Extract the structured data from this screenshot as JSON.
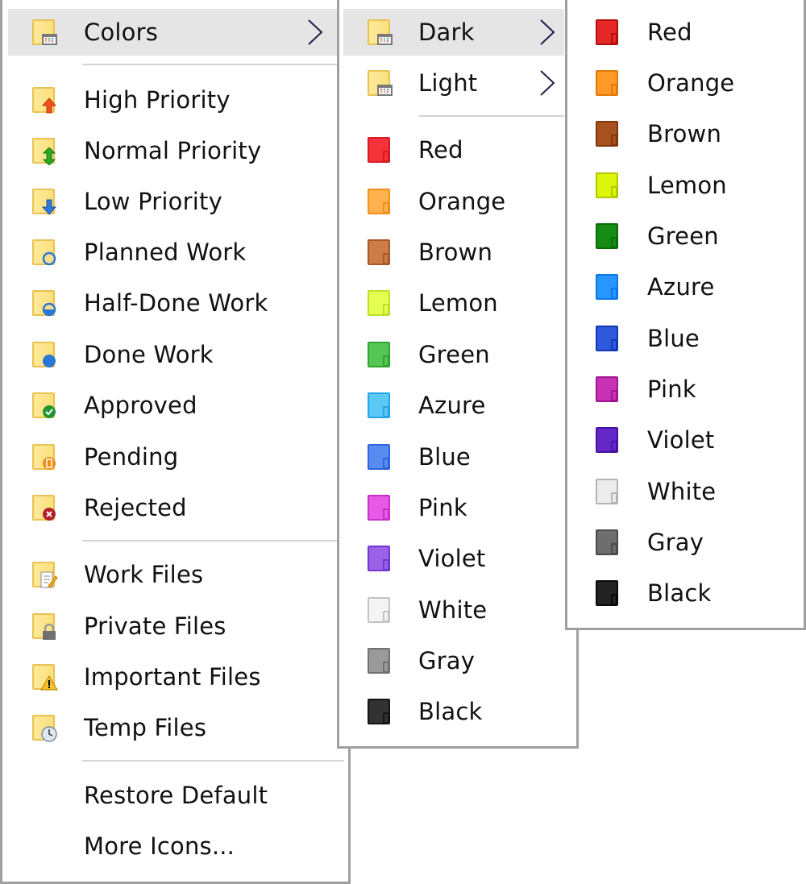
{
  "menu1": {
    "items": [
      {
        "label": "Colors",
        "icon": "colors-folder-icon",
        "submenu": true,
        "highlighted": true
      },
      {
        "label": "High Priority",
        "icon": "high-priority-icon"
      },
      {
        "label": "Normal Priority",
        "icon": "normal-priority-icon"
      },
      {
        "label": "Low Priority",
        "icon": "low-priority-icon"
      },
      {
        "label": "Planned Work",
        "icon": "planned-work-icon"
      },
      {
        "label": "Half-Done Work",
        "icon": "half-done-work-icon"
      },
      {
        "label": "Done Work",
        "icon": "done-work-icon"
      },
      {
        "label": "Approved",
        "icon": "approved-icon"
      },
      {
        "label": "Pending",
        "icon": "pending-icon"
      },
      {
        "label": "Rejected",
        "icon": "rejected-icon"
      },
      {
        "label": "Work Files",
        "icon": "work-files-icon"
      },
      {
        "label": "Private Files",
        "icon": "private-files-icon"
      },
      {
        "label": "Important Files",
        "icon": "important-files-icon"
      },
      {
        "label": "Temp Files",
        "icon": "temp-files-icon"
      },
      {
        "label": "Restore Default"
      },
      {
        "label": "More Icons..."
      }
    ]
  },
  "menu2": {
    "submenus": [
      {
        "label": "Dark",
        "icon": "colors-folder-icon",
        "submenu": true,
        "highlighted": true
      },
      {
        "label": "Light",
        "icon": "colors-folder-icon",
        "submenu": true
      }
    ],
    "colors": [
      {
        "label": "Red",
        "fill": "#f5323a",
        "edge": "#d41c24"
      },
      {
        "label": "Orange",
        "fill": "#ffb24d",
        "edge": "#f0901c"
      },
      {
        "label": "Brown",
        "fill": "#cc7c46",
        "edge": "#a8562a"
      },
      {
        "label": "Lemon",
        "fill": "#e4ff50",
        "edge": "#bde02a"
      },
      {
        "label": "Green",
        "fill": "#55c555",
        "edge": "#2fa52f"
      },
      {
        "label": "Azure",
        "fill": "#5cc8f5",
        "edge": "#22a6e8"
      },
      {
        "label": "Blue",
        "fill": "#5a8cf0",
        "edge": "#2d62e0"
      },
      {
        "label": "Pink",
        "fill": "#e65ae6",
        "edge": "#c82ec8"
      },
      {
        "label": "Violet",
        "fill": "#9a62e6",
        "edge": "#7436d0"
      },
      {
        "label": "White",
        "fill": "#f4f4f4",
        "edge": "#c4c4c4"
      },
      {
        "label": "Gray",
        "fill": "#9a9a9a",
        "edge": "#707070"
      },
      {
        "label": "Black",
        "fill": "#323232",
        "edge": "#141414"
      }
    ]
  },
  "menu3": {
    "colors": [
      {
        "label": "Red",
        "fill": "#e62828",
        "edge": "#b01010"
      },
      {
        "label": "Orange",
        "fill": "#ff9a28",
        "edge": "#e07a0a"
      },
      {
        "label": "Brown",
        "fill": "#a8501e",
        "edge": "#80360e"
      },
      {
        "label": "Lemon",
        "fill": "#dcf50a",
        "edge": "#b0c800"
      },
      {
        "label": "Green",
        "fill": "#148c14",
        "edge": "#0a6a0a"
      },
      {
        "label": "Azure",
        "fill": "#2896ff",
        "edge": "#0a78e6"
      },
      {
        "label": "Blue",
        "fill": "#2d5adc",
        "edge": "#1438b4"
      },
      {
        "label": "Pink",
        "fill": "#c832b4",
        "edge": "#a01490"
      },
      {
        "label": "Violet",
        "fill": "#6428c8",
        "edge": "#4614a0"
      },
      {
        "label": "White",
        "fill": "#ececec",
        "edge": "#b4b4b4"
      },
      {
        "label": "Gray",
        "fill": "#6e6e6e",
        "edge": "#4a4a4a"
      },
      {
        "label": "Black",
        "fill": "#232323",
        "edge": "#0a0a0a"
      }
    ]
  }
}
